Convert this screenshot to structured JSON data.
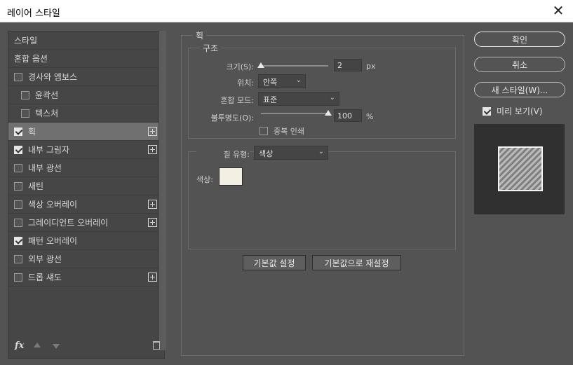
{
  "window": {
    "title": "레이어 스타일",
    "close": "✕"
  },
  "sidebar": {
    "items": [
      {
        "label": "스타일",
        "checkbox": false,
        "checked": false,
        "plus": false,
        "indent": 0
      },
      {
        "label": "혼합 옵션",
        "checkbox": false,
        "checked": false,
        "plus": false,
        "indent": 0
      },
      {
        "label": "경사와 엠보스",
        "checkbox": true,
        "checked": false,
        "plus": false,
        "indent": 0
      },
      {
        "label": "윤곽선",
        "checkbox": true,
        "checked": false,
        "plus": false,
        "indent": 1
      },
      {
        "label": "텍스처",
        "checkbox": true,
        "checked": false,
        "plus": false,
        "indent": 1
      },
      {
        "label": "획",
        "checkbox": true,
        "checked": true,
        "plus": true,
        "indent": 0,
        "selected": true
      },
      {
        "label": "내부 그림자",
        "checkbox": true,
        "checked": true,
        "plus": true,
        "indent": 0
      },
      {
        "label": "내부 광선",
        "checkbox": true,
        "checked": false,
        "plus": false,
        "indent": 0
      },
      {
        "label": "새틴",
        "checkbox": true,
        "checked": false,
        "plus": false,
        "indent": 0
      },
      {
        "label": "색상 오버레이",
        "checkbox": true,
        "checked": false,
        "plus": true,
        "indent": 0
      },
      {
        "label": "그레이디언트 오버레이",
        "checkbox": true,
        "checked": false,
        "plus": true,
        "indent": 0
      },
      {
        "label": "패턴 오버레이",
        "checkbox": true,
        "checked": true,
        "plus": false,
        "indent": 0
      },
      {
        "label": "외부 광선",
        "checkbox": true,
        "checked": false,
        "plus": false,
        "indent": 0
      },
      {
        "label": "드롭 섀도",
        "checkbox": true,
        "checked": false,
        "plus": true,
        "indent": 0
      }
    ],
    "fx_label": "fx"
  },
  "stroke": {
    "section_title": "획",
    "structure_title": "구조",
    "size_label": "크기(S):",
    "size_value": "2",
    "size_slider_fraction": 0.0,
    "size_unit": "px",
    "position_label": "위치:",
    "position_value": "안쪽",
    "blend_label": "혼합 모드:",
    "blend_value": "표준",
    "opacity_label": "불투명도(O):",
    "opacity_value": "100",
    "opacity_slider_fraction": 1.0,
    "opacity_unit": "%",
    "overprint_label": "중복 인쇄",
    "fill_type_label": "칠 유형:",
    "fill_type_value": "색상",
    "color_label": "색상:",
    "color_value": "#f3efe2",
    "make_default_label": "기본값 설정",
    "reset_default_label": "기본값으로 재설정"
  },
  "actions": {
    "ok_label": "확인",
    "cancel_label": "취소",
    "new_style_label": "새 스타일(W)...",
    "preview_label": "미리 보기(V)",
    "preview_checked": true
  }
}
